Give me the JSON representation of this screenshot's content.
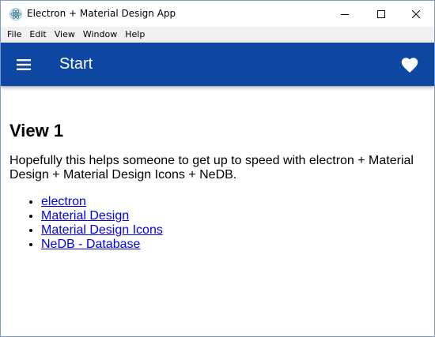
{
  "window": {
    "title": "Electron + Material Design App",
    "controls": [
      "minimize-icon",
      "maximize-icon",
      "close-icon"
    ]
  },
  "menubar": {
    "items": [
      {
        "label": "File"
      },
      {
        "label": "Edit"
      },
      {
        "label": "View"
      },
      {
        "label": "Window"
      },
      {
        "label": "Help"
      }
    ]
  },
  "toolbar": {
    "title": "Start",
    "menu_icon": "menu-icon",
    "action_icon": "heart-icon",
    "color": "#0d47a1"
  },
  "content": {
    "heading": "View 1",
    "paragraph": "Hopefully this helps someone to get up to speed with electron + Material Design + Material Design Icons + NeDB.",
    "links": [
      {
        "label": "electron"
      },
      {
        "label": "Material Design"
      },
      {
        "label": "Material Design Icons"
      },
      {
        "label": "NeDB - Database"
      }
    ]
  }
}
